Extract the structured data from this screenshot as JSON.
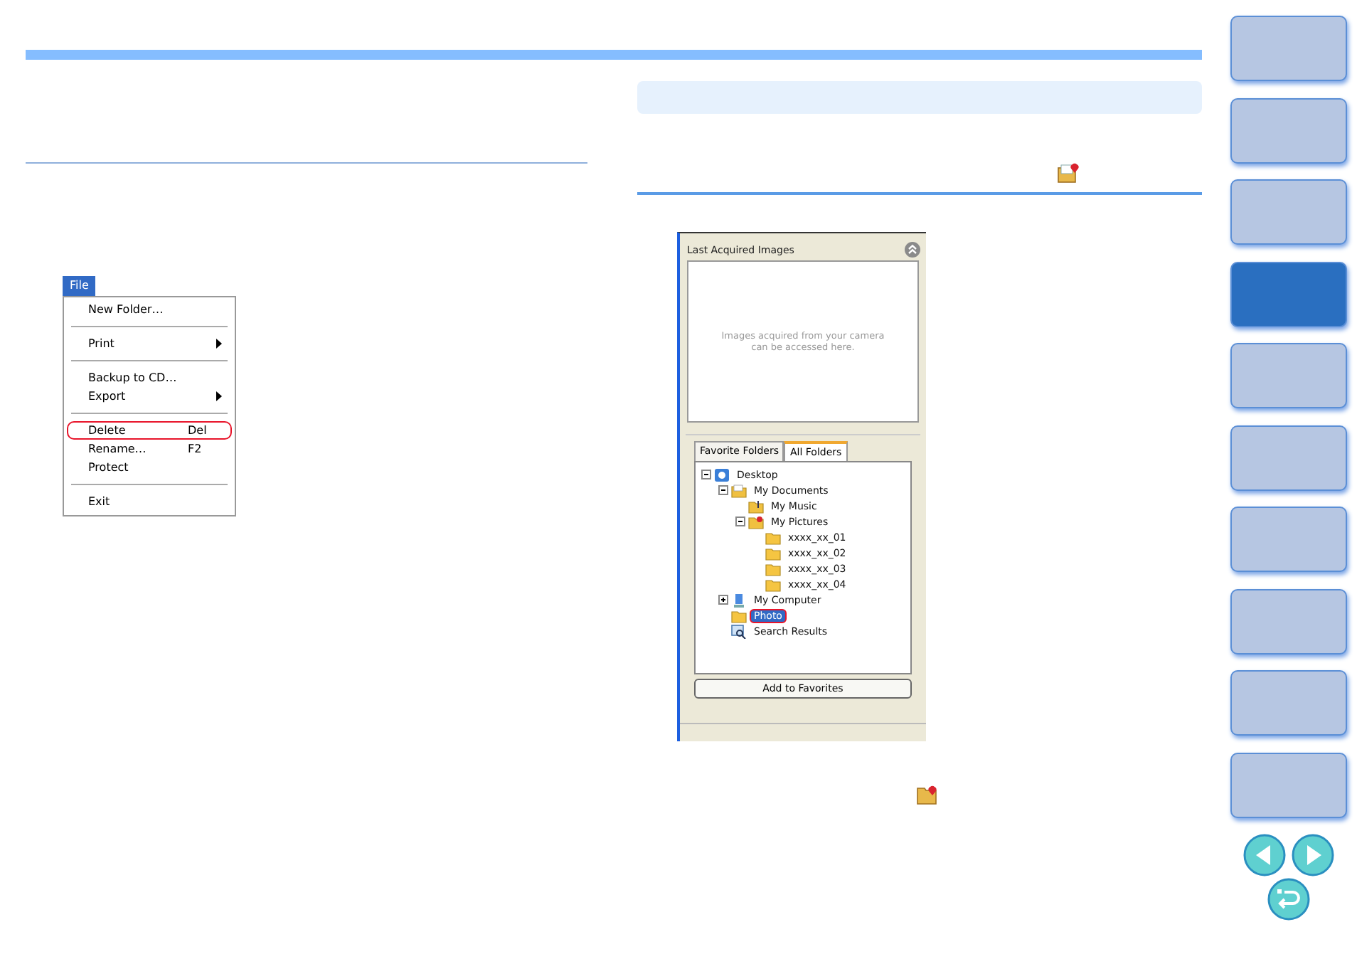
{
  "file_menu": {
    "title": "File",
    "items": [
      {
        "kind": "item",
        "label": "New Folder…",
        "submenu": false,
        "highlighted": false
      },
      {
        "kind": "separator"
      },
      {
        "kind": "item",
        "label": "Print",
        "submenu": true,
        "highlighted": false
      },
      {
        "kind": "separator"
      },
      {
        "kind": "item",
        "label": "Backup to CD…",
        "submenu": false,
        "highlighted": false
      },
      {
        "kind": "item",
        "label": "Export",
        "submenu": true,
        "highlighted": false
      },
      {
        "kind": "separator"
      },
      {
        "kind": "item",
        "label": "Delete",
        "shortcut": "Del",
        "submenu": false,
        "highlighted": true
      },
      {
        "kind": "item",
        "label": "Rename…",
        "shortcut": "F2",
        "submenu": false,
        "highlighted": false
      },
      {
        "kind": "item",
        "label": "Protect",
        "submenu": false,
        "highlighted": false
      },
      {
        "kind": "separator"
      },
      {
        "kind": "item",
        "label": "Exit",
        "submenu": false,
        "highlighted": false
      }
    ]
  },
  "browser_panel": {
    "header": "Last Acquired Images",
    "empty_message": "Images acquired from your camera can be accessed here.",
    "tabs": [
      {
        "label": "Favorite Folders",
        "selected": false
      },
      {
        "label": "All Folders",
        "selected": true
      }
    ],
    "tree": [
      {
        "label": "Desktop",
        "kind": "desktop",
        "expanded": true,
        "selected": false,
        "highlighted": false,
        "children": [
          {
            "label": "My Documents",
            "kind": "documents",
            "expanded": true,
            "selected": false,
            "highlighted": false,
            "children": [
              {
                "label": "My Music",
                "kind": "music",
                "selected": false,
                "highlighted": false
              },
              {
                "label": "My Pictures",
                "kind": "pictures",
                "expanded": true,
                "selected": false,
                "highlighted": false,
                "children": [
                  {
                    "label": "xxxx_xx_01",
                    "kind": "folder",
                    "selected": false,
                    "highlighted": false
                  },
                  {
                    "label": "xxxx_xx_02",
                    "kind": "folder",
                    "selected": false,
                    "highlighted": false
                  },
                  {
                    "label": "xxxx_xx_03",
                    "kind": "folder",
                    "selected": false,
                    "highlighted": false
                  },
                  {
                    "label": "xxxx_xx_04",
                    "kind": "folder",
                    "selected": false,
                    "highlighted": false
                  }
                ]
              }
            ]
          },
          {
            "label": "My Computer",
            "kind": "computer",
            "expanded": false,
            "selected": false,
            "highlighted": false
          },
          {
            "label": "Photo",
            "kind": "folder",
            "selected": true,
            "highlighted": true
          },
          {
            "label": "Search Results",
            "kind": "search",
            "selected": false,
            "highlighted": false
          }
        ]
      }
    ],
    "button": "Add to Favorites"
  },
  "side_nav": [
    {
      "selected": false
    },
    {
      "selected": false
    },
    {
      "selected": false
    },
    {
      "selected": true
    },
    {
      "selected": false
    },
    {
      "selected": false
    },
    {
      "selected": false
    },
    {
      "selected": false
    },
    {
      "selected": false
    },
    {
      "selected": false
    }
  ]
}
